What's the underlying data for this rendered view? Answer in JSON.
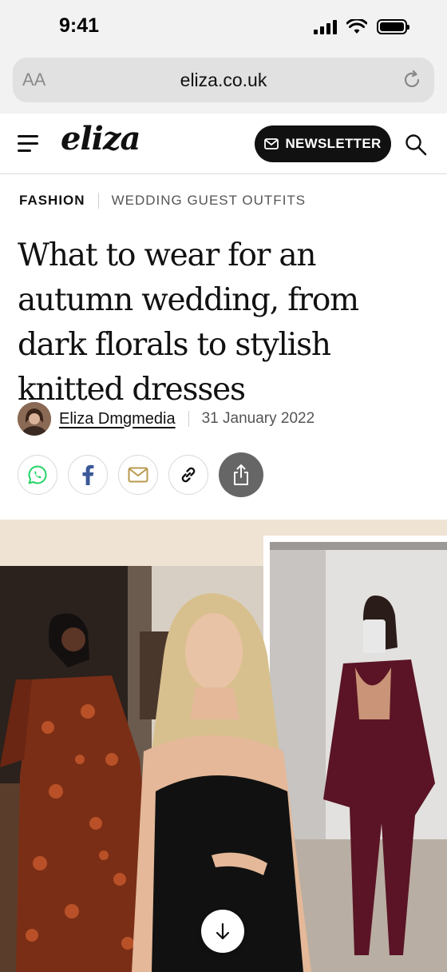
{
  "status_bar": {
    "time": "9:41"
  },
  "browser": {
    "aa_label": "AA",
    "url": "eliza.co.uk"
  },
  "header": {
    "logo": "eliza",
    "newsletter_label": "NEWSLETTER"
  },
  "breadcrumb": {
    "section": "FASHION",
    "subsection": "WEDDING GUEST OUTFITS"
  },
  "article": {
    "headline": "What to wear for an autumn wedding, from dark florals to stylish knitted dresses",
    "author": "Eliza Dmgmedia",
    "date": "31 January 2022"
  },
  "share": {
    "icons": [
      "whatsapp-icon",
      "facebook-icon",
      "email-icon",
      "link-icon",
      "share-icon"
    ]
  },
  "hero": {
    "scroll_icon": "arrow-down-icon"
  },
  "colors": {
    "dark": "#111111",
    "whatsapp": "#25D366",
    "facebook": "#3b5998",
    "email": "#b99a4f",
    "share_bg": "#666666"
  }
}
